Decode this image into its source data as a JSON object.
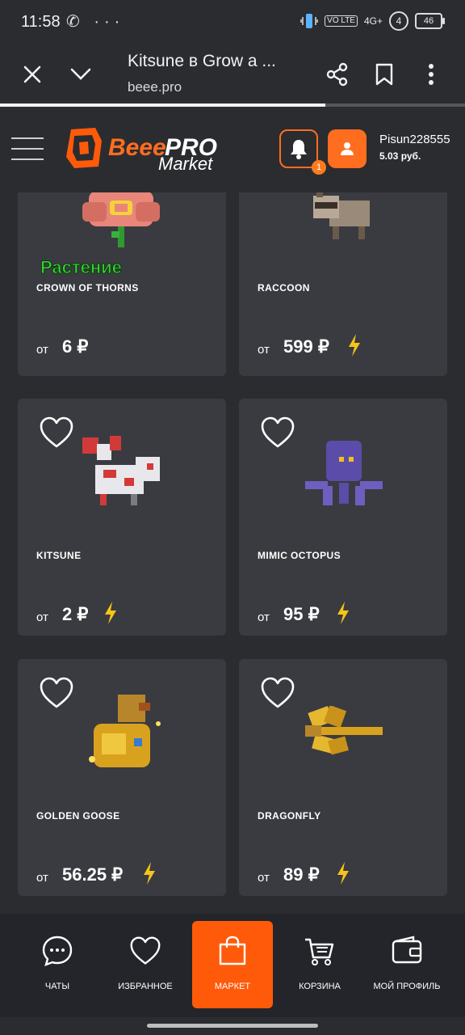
{
  "status_bar": {
    "time": "11:58",
    "left_icons": "✆ ···",
    "volte": "VO LTE",
    "network": "4G+",
    "sim": "4",
    "battery": "46"
  },
  "browser": {
    "title": "Kitsune в Grow a ...",
    "url": "beee.pro",
    "load_progress": 0.7
  },
  "header": {
    "logo_beee": "Beee",
    "logo_pro": "PRO",
    "logo_market": "Market",
    "notification_count": "1",
    "username": "Pisun228555",
    "balance": "5.03 руб."
  },
  "cards": [
    {
      "name": "CROWN OF THORNS",
      "price_prefix": "от",
      "price": "6 ₽",
      "tag": "Растение",
      "has_bolt": false,
      "has_heart": false
    },
    {
      "name": "RACCOON",
      "price_prefix": "от",
      "price": "599 ₽",
      "has_bolt": true,
      "has_heart": false
    },
    {
      "name": "KITSUNE",
      "price_prefix": "от",
      "price": "2 ₽",
      "has_bolt": true,
      "has_heart": true
    },
    {
      "name": "MIMIC OCTOPUS",
      "price_prefix": "от",
      "price": "95 ₽",
      "has_bolt": true,
      "has_heart": true
    },
    {
      "name": "GOLDEN GOOSE",
      "price_prefix": "от",
      "price": "56.25 ₽",
      "has_bolt": true,
      "has_heart": true
    },
    {
      "name": "DRAGONFLY",
      "price_prefix": "от",
      "price": "89 ₽",
      "has_bolt": true,
      "has_heart": true
    }
  ],
  "bottom_nav": [
    {
      "label": "ЧАТЫ",
      "icon": "chat-icon",
      "active": false
    },
    {
      "label": "ИЗБРАННОЕ",
      "icon": "heart-icon",
      "active": false
    },
    {
      "label": "МАРКЕТ",
      "icon": "shopping-bag-icon",
      "active": true
    },
    {
      "label": "КОРЗИНА",
      "icon": "cart-icon",
      "active": false
    },
    {
      "label": "МОЙ ПРОФИЛЬ",
      "icon": "wallet-icon",
      "active": false
    }
  ],
  "colors": {
    "accent": "#ff6d1f",
    "card_bg": "#3a3b40",
    "page_bg": "#2b2c30",
    "bolt": "#f5c518"
  }
}
